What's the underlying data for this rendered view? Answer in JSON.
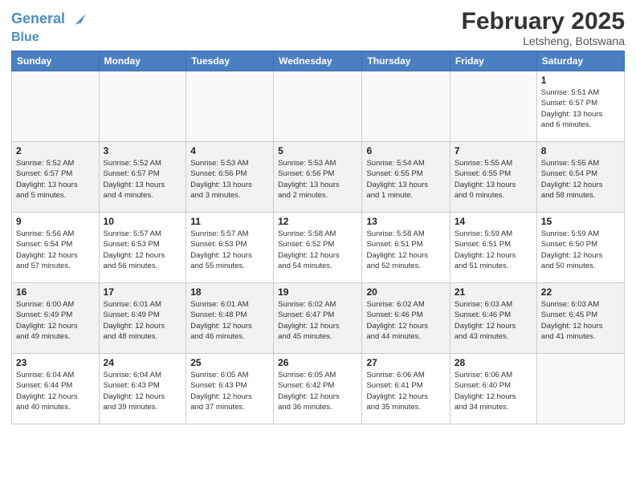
{
  "header": {
    "logo_line1": "General",
    "logo_line2": "Blue",
    "month": "February 2025",
    "location": "Letsheng, Botswana"
  },
  "weekdays": [
    "Sunday",
    "Monday",
    "Tuesday",
    "Wednesday",
    "Thursday",
    "Friday",
    "Saturday"
  ],
  "weeks": [
    [
      {
        "day": "",
        "info": ""
      },
      {
        "day": "",
        "info": ""
      },
      {
        "day": "",
        "info": ""
      },
      {
        "day": "",
        "info": ""
      },
      {
        "day": "",
        "info": ""
      },
      {
        "day": "",
        "info": ""
      },
      {
        "day": "1",
        "info": "Sunrise: 5:51 AM\nSunset: 6:57 PM\nDaylight: 13 hours\nand 6 minutes."
      }
    ],
    [
      {
        "day": "2",
        "info": "Sunrise: 5:52 AM\nSunset: 6:57 PM\nDaylight: 13 hours\nand 5 minutes."
      },
      {
        "day": "3",
        "info": "Sunrise: 5:52 AM\nSunset: 6:57 PM\nDaylight: 13 hours\nand 4 minutes."
      },
      {
        "day": "4",
        "info": "Sunrise: 5:53 AM\nSunset: 6:56 PM\nDaylight: 13 hours\nand 3 minutes."
      },
      {
        "day": "5",
        "info": "Sunrise: 5:53 AM\nSunset: 6:56 PM\nDaylight: 13 hours\nand 2 minutes."
      },
      {
        "day": "6",
        "info": "Sunrise: 5:54 AM\nSunset: 6:55 PM\nDaylight: 13 hours\nand 1 minute."
      },
      {
        "day": "7",
        "info": "Sunrise: 5:55 AM\nSunset: 6:55 PM\nDaylight: 13 hours\nand 0 minutes."
      },
      {
        "day": "8",
        "info": "Sunrise: 5:55 AM\nSunset: 6:54 PM\nDaylight: 12 hours\nand 58 minutes."
      }
    ],
    [
      {
        "day": "9",
        "info": "Sunrise: 5:56 AM\nSunset: 6:54 PM\nDaylight: 12 hours\nand 57 minutes."
      },
      {
        "day": "10",
        "info": "Sunrise: 5:57 AM\nSunset: 6:53 PM\nDaylight: 12 hours\nand 56 minutes."
      },
      {
        "day": "11",
        "info": "Sunrise: 5:57 AM\nSunset: 6:53 PM\nDaylight: 12 hours\nand 55 minutes."
      },
      {
        "day": "12",
        "info": "Sunrise: 5:58 AM\nSunset: 6:52 PM\nDaylight: 12 hours\nand 54 minutes."
      },
      {
        "day": "13",
        "info": "Sunrise: 5:58 AM\nSunset: 6:51 PM\nDaylight: 12 hours\nand 52 minutes."
      },
      {
        "day": "14",
        "info": "Sunrise: 5:59 AM\nSunset: 6:51 PM\nDaylight: 12 hours\nand 51 minutes."
      },
      {
        "day": "15",
        "info": "Sunrise: 5:59 AM\nSunset: 6:50 PM\nDaylight: 12 hours\nand 50 minutes."
      }
    ],
    [
      {
        "day": "16",
        "info": "Sunrise: 6:00 AM\nSunset: 6:49 PM\nDaylight: 12 hours\nand 49 minutes."
      },
      {
        "day": "17",
        "info": "Sunrise: 6:01 AM\nSunset: 6:49 PM\nDaylight: 12 hours\nand 48 minutes."
      },
      {
        "day": "18",
        "info": "Sunrise: 6:01 AM\nSunset: 6:48 PM\nDaylight: 12 hours\nand 46 minutes."
      },
      {
        "day": "19",
        "info": "Sunrise: 6:02 AM\nSunset: 6:47 PM\nDaylight: 12 hours\nand 45 minutes."
      },
      {
        "day": "20",
        "info": "Sunrise: 6:02 AM\nSunset: 6:46 PM\nDaylight: 12 hours\nand 44 minutes."
      },
      {
        "day": "21",
        "info": "Sunrise: 6:03 AM\nSunset: 6:46 PM\nDaylight: 12 hours\nand 43 minutes."
      },
      {
        "day": "22",
        "info": "Sunrise: 6:03 AM\nSunset: 6:45 PM\nDaylight: 12 hours\nand 41 minutes."
      }
    ],
    [
      {
        "day": "23",
        "info": "Sunrise: 6:04 AM\nSunset: 6:44 PM\nDaylight: 12 hours\nand 40 minutes."
      },
      {
        "day": "24",
        "info": "Sunrise: 6:04 AM\nSunset: 6:43 PM\nDaylight: 12 hours\nand 39 minutes."
      },
      {
        "day": "25",
        "info": "Sunrise: 6:05 AM\nSunset: 6:43 PM\nDaylight: 12 hours\nand 37 minutes."
      },
      {
        "day": "26",
        "info": "Sunrise: 6:05 AM\nSunset: 6:42 PM\nDaylight: 12 hours\nand 36 minutes."
      },
      {
        "day": "27",
        "info": "Sunrise: 6:06 AM\nSunset: 6:41 PM\nDaylight: 12 hours\nand 35 minutes."
      },
      {
        "day": "28",
        "info": "Sunrise: 6:06 AM\nSunset: 6:40 PM\nDaylight: 12 hours\nand 34 minutes."
      },
      {
        "day": "",
        "info": ""
      }
    ]
  ]
}
